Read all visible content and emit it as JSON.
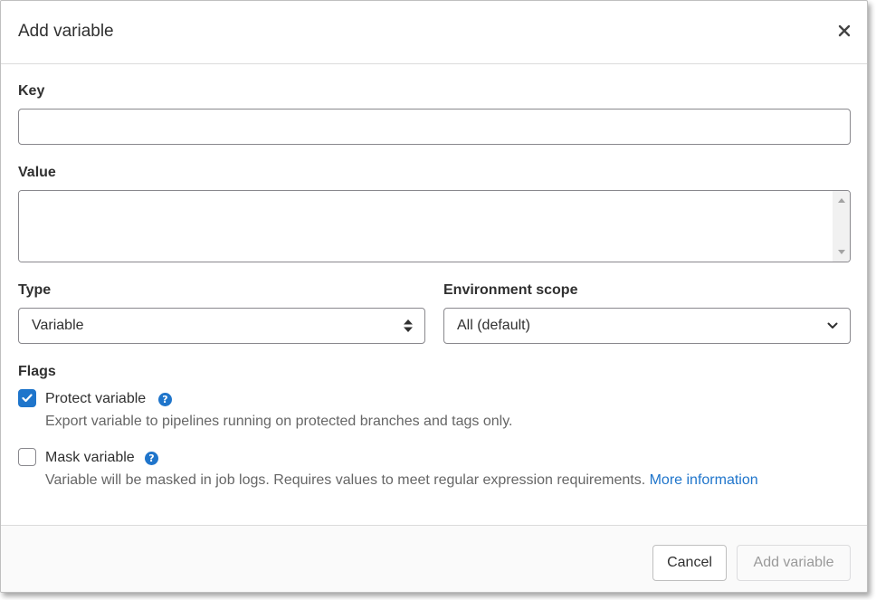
{
  "modal": {
    "title": "Add variable"
  },
  "form": {
    "key": {
      "label": "Key",
      "value": "",
      "placeholder": ""
    },
    "value": {
      "label": "Value",
      "value": ""
    },
    "type": {
      "label": "Type",
      "selected": "Variable"
    },
    "environment_scope": {
      "label": "Environment scope",
      "selected": "All (default)"
    },
    "flags": {
      "label": "Flags",
      "protect": {
        "title": "Protect variable",
        "description": "Export variable to pipelines running on protected branches and tags only.",
        "checked": true,
        "help_icon": "?"
      },
      "mask": {
        "title": "Mask variable",
        "description": "Variable will be masked in job logs. Requires values to meet regular expression requirements.",
        "link": "More information",
        "checked": false,
        "help_icon": "?"
      }
    }
  },
  "footer": {
    "cancel_label": "Cancel",
    "submit_label": "Add variable"
  },
  "colors": {
    "accent": "#1f75cb",
    "text": "#303030",
    "muted": "#666666",
    "border": "#89888d"
  },
  "icons": {
    "close": "close-icon",
    "check": "check-icon",
    "help": "question-circle-icon",
    "select_arrows": "sort-arrows-icon",
    "chevron": "chevron-down-icon"
  }
}
